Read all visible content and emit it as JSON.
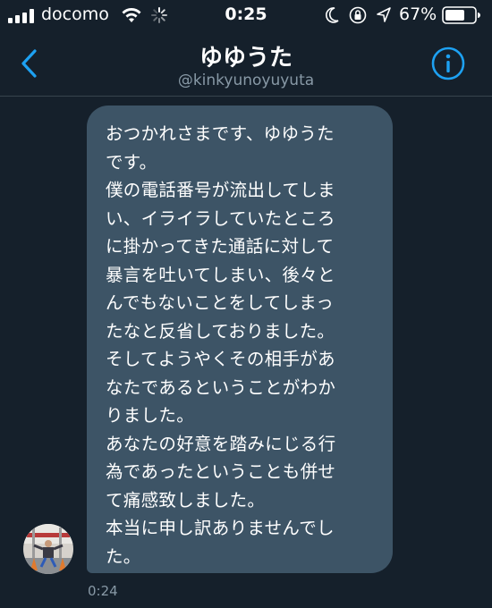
{
  "status_bar": {
    "carrier": "docomo",
    "time": "0:25",
    "battery_percent": "67%",
    "icons": [
      "signal-bars-icon",
      "wifi-icon",
      "loading-spinner-icon",
      "moon-icon",
      "orientation-lock-icon",
      "location-arrow-icon",
      "battery-icon"
    ]
  },
  "header": {
    "title": "ゆゆうた",
    "handle": "@kinkyunoyuyuta",
    "back_icon": "chevron-left-icon",
    "info_icon": "info-icon"
  },
  "message": {
    "text": "おつかれさまです、ゆゆうた\nです。\n僕の電話番号が流出してしま\nい、イライラしていたところ\nに掛かってきた通話に対して\n暴言を吐いてしまい、後々と\nんでもないことをしてしまっ\nたなと反省しておりました。\nそしてようやくその相手があ\nなたであるということがわか\nりました。\nあなたの好意を踏みにじる行\n為であったということも併せ\nて痛感致しました。\n本当に申し訳ありませんでし\nた。",
    "timestamp": "0:24"
  },
  "colors": {
    "background": "#15202b",
    "bubble": "#3d5466",
    "accent": "#1da1f2",
    "secondary_text": "#8899a6"
  }
}
